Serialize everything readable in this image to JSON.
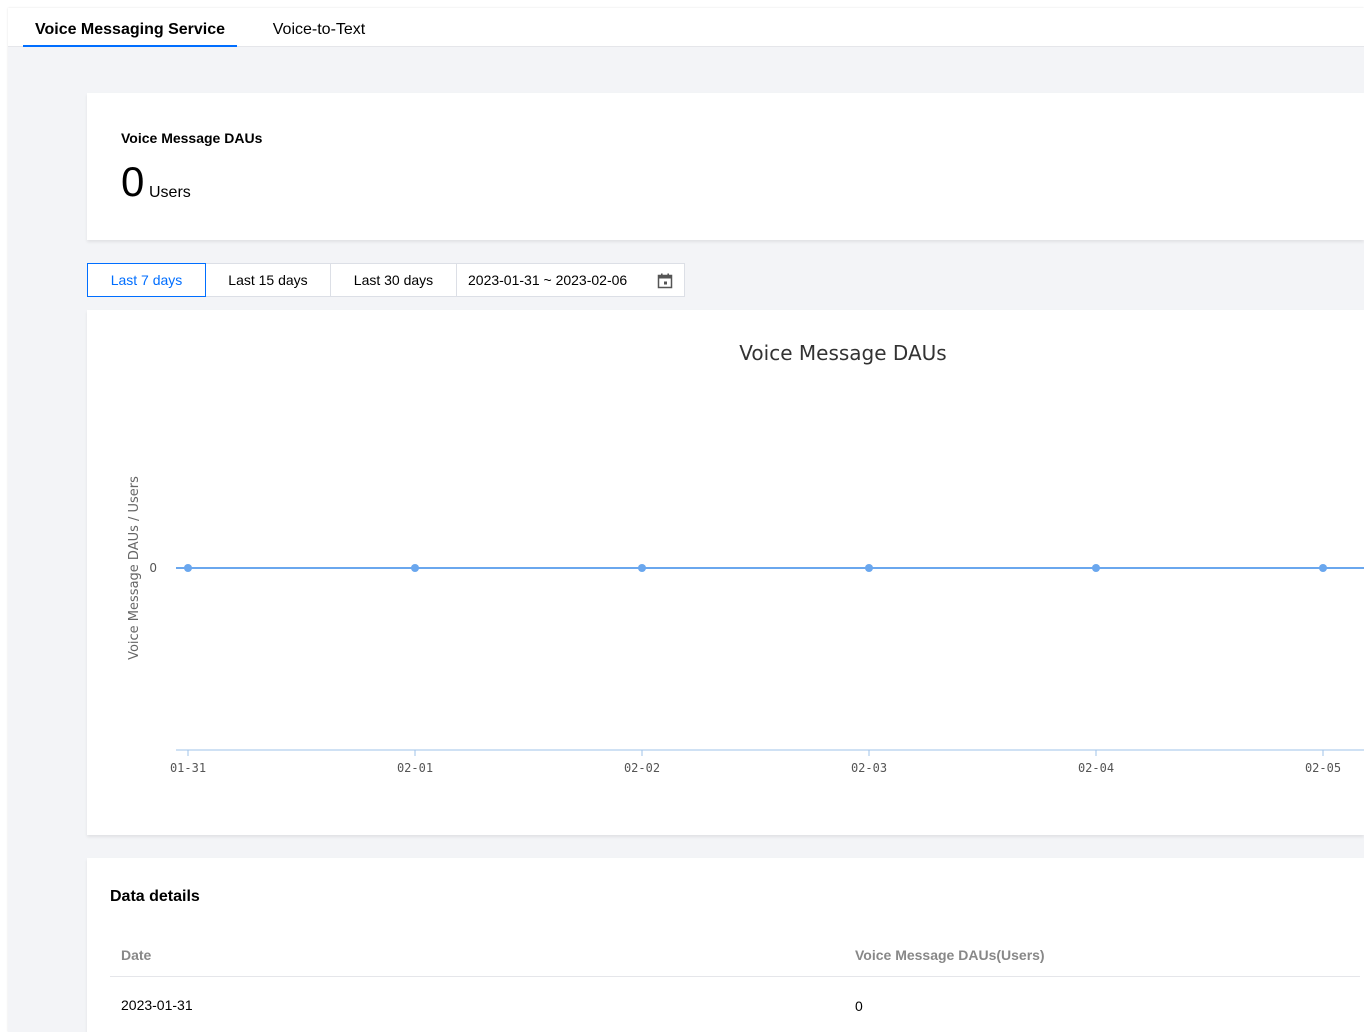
{
  "tabs": [
    {
      "label": "Voice Messaging Service",
      "active": true
    },
    {
      "label": "Voice-to-Text",
      "active": false
    }
  ],
  "kpi": {
    "title": "Voice Message DAUs",
    "value": "0",
    "unit": "Users"
  },
  "range": {
    "options": [
      "Last 7 days",
      "Last 15 days",
      "Last 30 days"
    ],
    "active_index": 0,
    "date_range": "2023-01-31 ~ 2023-02-06",
    "icon": "calendar-icon"
  },
  "chart_data": {
    "type": "line",
    "title": "Voice Message DAUs",
    "ylabel": "Voice Message DAUs / Users",
    "xlabel": "",
    "x": [
      "01-31",
      "02-01",
      "02-02",
      "02-03",
      "02-04",
      "02-05"
    ],
    "series": [
      {
        "values": [
          0,
          0,
          0,
          0,
          0,
          0
        ],
        "color": "#6aa7ee"
      }
    ],
    "y_ticks": [
      "0"
    ],
    "grid": false
  },
  "details": {
    "title": "Data details",
    "columns": [
      "Date",
      "Voice Message DAUs(Users)"
    ],
    "rows": [
      [
        "2023-01-31",
        "0"
      ]
    ]
  },
  "colors": {
    "accent": "#006eff",
    "line": "#6aa7ee",
    "background": "#f3f4f7"
  }
}
